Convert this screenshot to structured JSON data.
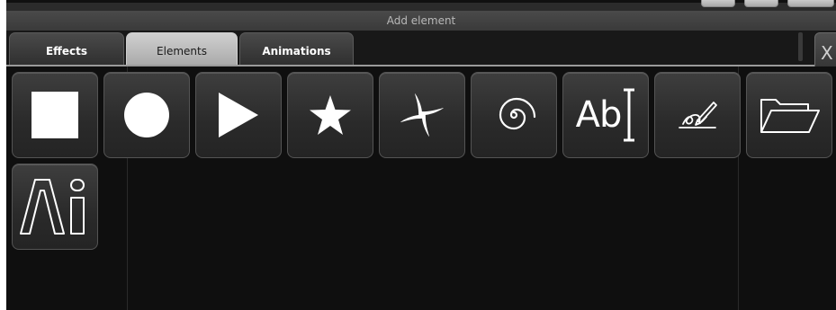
{
  "window": {
    "title": "Add element"
  },
  "tabs": [
    {
      "label": "Effects",
      "active": false
    },
    {
      "label": "Elements",
      "active": true
    },
    {
      "label": "Animations",
      "active": false
    }
  ],
  "side_button": {
    "label": "X"
  },
  "elements": [
    {
      "icon": "square-icon"
    },
    {
      "icon": "circle-icon"
    },
    {
      "icon": "triangle-icon"
    },
    {
      "icon": "star-icon"
    },
    {
      "icon": "pinwheel-icon"
    },
    {
      "icon": "spiral-icon"
    },
    {
      "icon": "text-icon",
      "label": "Ab"
    },
    {
      "icon": "signature-icon"
    },
    {
      "icon": "folder-icon"
    },
    {
      "icon": "illustrator-icon"
    }
  ],
  "colors": {
    "background": "#101010",
    "tile": "#2e2e2e",
    "active_tab": "#bcbcbc",
    "icon": "#ffffff"
  }
}
